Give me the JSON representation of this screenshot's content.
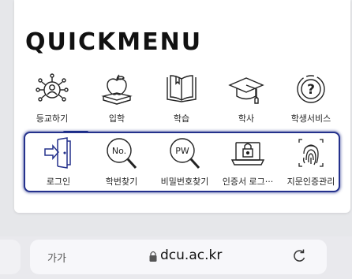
{
  "quickmenu": {
    "title": "QUICKMENU",
    "items": [
      {
        "label": "등교하기",
        "icon": "people-network-icon"
      },
      {
        "label": "입학",
        "icon": "apple-books-icon"
      },
      {
        "label": "학습",
        "icon": "open-book-icon"
      },
      {
        "label": "학사",
        "icon": "graduation-cap-icon"
      },
      {
        "label": "학생서비스",
        "icon": "question-icon"
      }
    ],
    "active_item": "등교하기"
  },
  "submenu": {
    "items": [
      {
        "label": "로그인",
        "icon": "door-enter-icon"
      },
      {
        "label": "학번찾기",
        "icon": "search-number-icon",
        "badge": "No."
      },
      {
        "label": "비밀번호찾기",
        "icon": "search-password-icon",
        "badge": "PW"
      },
      {
        "label": "인증서 로그···",
        "icon": "laptop-lock-icon"
      },
      {
        "label": "지문인증관리",
        "icon": "fingerprint-icon"
      }
    ]
  },
  "browser": {
    "text_size_label": "가가",
    "url": "dcu.ac.kr"
  },
  "colors": {
    "accent": "#24318c",
    "text": "#222222"
  }
}
